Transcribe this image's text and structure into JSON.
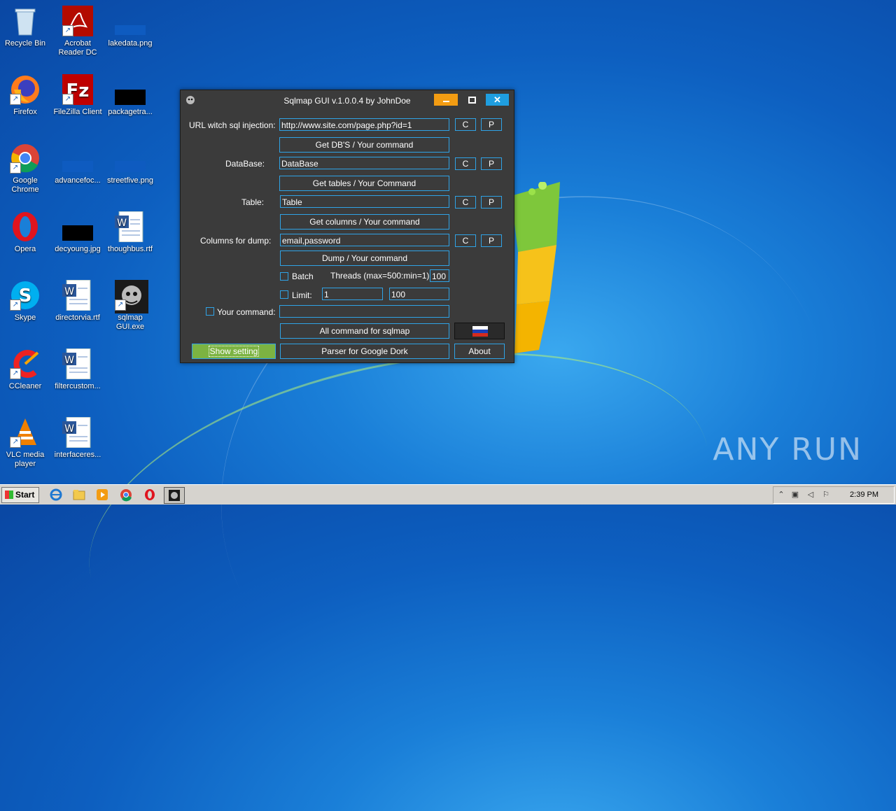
{
  "desktop": {
    "icons": [
      {
        "label": "Recycle Bin"
      },
      {
        "label": "Acrobat Reader DC"
      },
      {
        "label": "lakedata.png"
      },
      {
        "label": "Firefox"
      },
      {
        "label": "FileZilla Client"
      },
      {
        "label": "packagetra..."
      },
      {
        "label": "Google Chrome"
      },
      {
        "label": "advancefoc..."
      },
      {
        "label": "streetfive.png"
      },
      {
        "label": "Opera"
      },
      {
        "label": "decyoung.jpg"
      },
      {
        "label": "thoughbus.rtf"
      },
      {
        "label": "Skype"
      },
      {
        "label": "directorvia.rtf"
      },
      {
        "label": "sqlmap GUI.exe"
      },
      {
        "label": "CCleaner"
      },
      {
        "label": "filtercustom..."
      },
      {
        "label": "VLC media player"
      },
      {
        "label": "interfaceres..."
      }
    ],
    "watermark": "ANY RUN"
  },
  "app": {
    "title": "Sqlmap GUI v.1.0.0.4 by JohnDoe",
    "url_label": "URL witch sql injection:",
    "url_value": "http://www.site.com/page.php?id=1",
    "get_dbs_button": "Get DB'S / Your command",
    "database_label": "DataBase:",
    "database_value": "DataBase",
    "get_tables_button": "Get tables / Your Command",
    "table_label": "Table:",
    "table_value": "Table",
    "get_columns_button": "Get columns / Your command",
    "columns_label": "Columns for dump:",
    "columns_value": "email,password",
    "dump_button": "Dump / Your command",
    "batch_label": "Batch",
    "threads_label": "Threads (max=500:min=1)  :",
    "threads_value": "100",
    "limit_label": "Limit:",
    "limit_from": "1",
    "limit_to": "100",
    "your_command_label": "Your command:",
    "your_command_value": "",
    "all_commands_button": "All command for sqlmap",
    "show_setting_button": "Show setting",
    "parser_button": "Parser for Google Dork",
    "about_button": "About",
    "copy_label": "C",
    "paste_label": "P",
    "close_glyph": "✕"
  },
  "taskbar": {
    "start_label": "Start",
    "clock": "2:39 PM"
  },
  "colors": {
    "accent": "#2fa3e6",
    "window_bg": "#3b3b3b",
    "minimize": "#f39c12",
    "close": "#1f9ee0",
    "show_setting": "#7cb342"
  }
}
